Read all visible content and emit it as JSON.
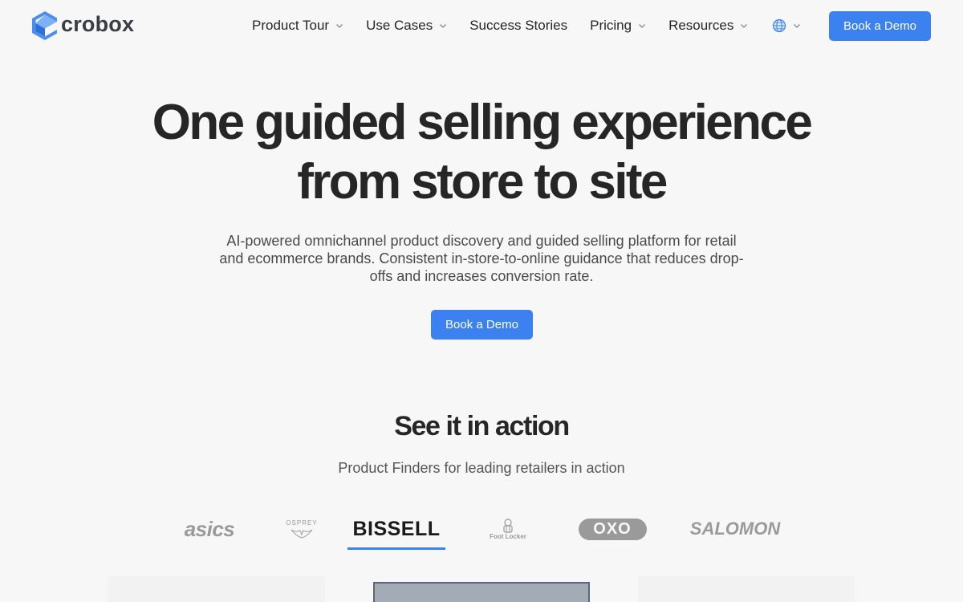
{
  "brand": {
    "name": "crobox",
    "logo_icon": "crobox-hexagon-icon"
  },
  "nav": {
    "items": [
      {
        "label": "Product Tour",
        "has_dropdown": true
      },
      {
        "label": "Use Cases",
        "has_dropdown": true
      },
      {
        "label": "Success Stories",
        "has_dropdown": false
      },
      {
        "label": "Pricing",
        "has_dropdown": true
      },
      {
        "label": "Resources",
        "has_dropdown": true
      }
    ],
    "language_icon": "globe-icon",
    "cta_label": "Book a Demo"
  },
  "hero": {
    "title_line1": "One guided selling experience",
    "title_line2": "from store to site",
    "subtitle": "AI-powered omnichannel product discovery and guided selling platform for retail and ecommerce brands. Consistent in-store-to-online guidance that reduces drop-offs and increases conversion rate.",
    "cta_label": "Book a Demo"
  },
  "showcase": {
    "title": "See it in action",
    "subtitle": "Product Finders for leading retailers in action",
    "logos": [
      {
        "name": "asics",
        "text": "asics",
        "active": false
      },
      {
        "name": "osprey",
        "text": "OSPREY",
        "active": false
      },
      {
        "name": "bissell",
        "text": "BISSELL",
        "active": true
      },
      {
        "name": "foot-locker",
        "text": "Foot Locker",
        "active": false
      },
      {
        "name": "oxo",
        "text": "OXO",
        "active": false
      },
      {
        "name": "salomon",
        "text": "SALOMON",
        "active": false
      }
    ]
  },
  "colors": {
    "accent": "#3b82f0",
    "logo_blue": "#4a8ef2",
    "text_dark": "#262626",
    "logo_gray": "#9a9a9a"
  }
}
